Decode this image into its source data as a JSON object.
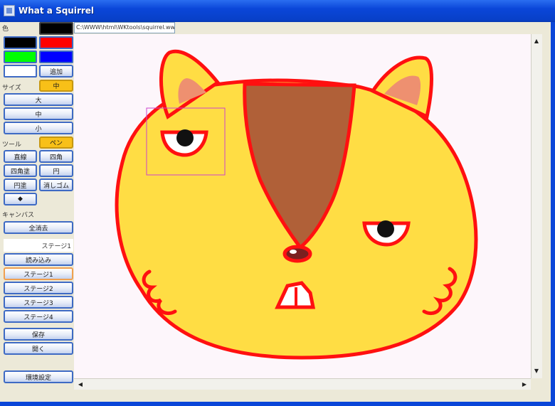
{
  "window": {
    "title": "What a Squirrel"
  },
  "path": "C:\\WWW\\html\\WKtools\\squirrel.wwf",
  "toolbar": {
    "color_label": "色",
    "swatches": [
      "#000000",
      "#000000",
      "#ff0000",
      "#00ff00",
      "#0000ff",
      "#ffffff"
    ],
    "swatch_button": "追加",
    "size_label": "サイズ",
    "size_selected": "中",
    "size_buttons": [
      "大",
      "中",
      "小"
    ],
    "tool_label": "ツール",
    "tool_selected": "ペン",
    "tool_buttons": [
      "直線",
      "四角",
      "四角塗",
      "円",
      "円塗",
      "消しゴム"
    ],
    "canvas_label": "キャンバス",
    "clear_button": "全消去",
    "stage_value": "ステージ1",
    "load_button": "読み込み",
    "stage_buttons": [
      "ステージ1",
      "ステージ2",
      "ステージ3",
      "ステージ4"
    ],
    "save_button": "保存",
    "open_button": "開く",
    "settings_button": "環境設定"
  },
  "colors": {
    "titlebar": "#0a46d8",
    "canvas_bg": "#fdf6fb",
    "fill": "#ffdd44",
    "outline": "#ff1010",
    "stripe": "#b06038",
    "ear_inner": "#ee9070",
    "selection": "#cc44cc"
  },
  "scrollbars": {
    "up": "▲",
    "down": "▼",
    "left": "◀",
    "right": "▶"
  }
}
